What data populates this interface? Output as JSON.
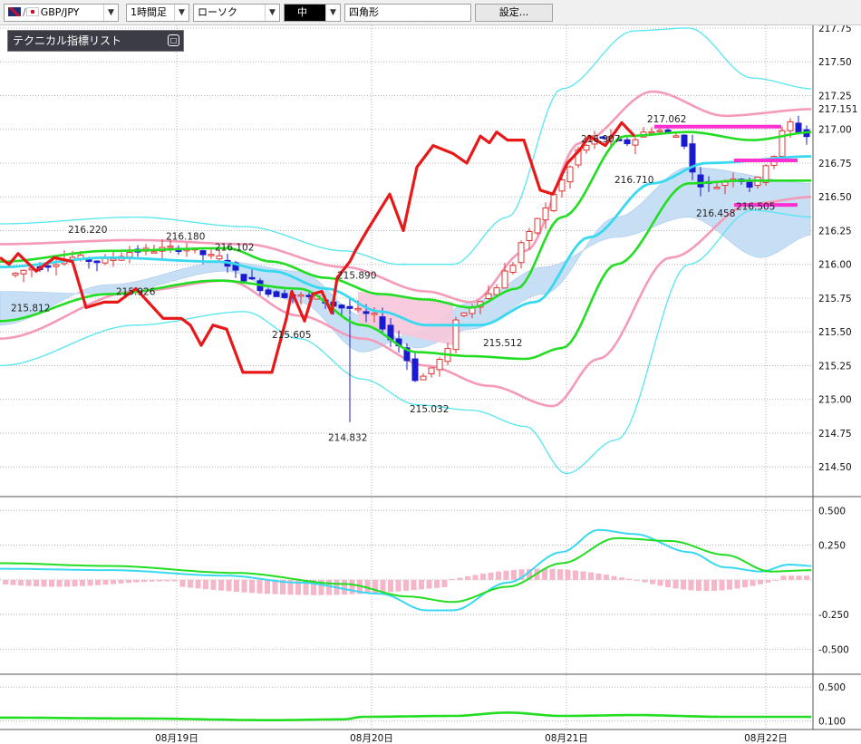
{
  "toolbar": {
    "symbol": "GBP/JPY",
    "timeframe": "1時間足",
    "chart_type": "ローソク",
    "line_width": "中",
    "shape": "四角形",
    "settings_label": "設定..."
  },
  "indicator_list": {
    "label": "テクニカル指標リスト"
  },
  "colors": {
    "bull_candle": "#e03030",
    "bear_candle": "#1a1ad0",
    "chikou": "#e81818",
    "moving_average": "#22dd22",
    "bollinger_inner": "#f59ab8",
    "bollinger_outer": "#55e6f0",
    "kijun": "#38d8f0",
    "cloud": "#c6dff5",
    "cloud_negative": "#f7c6da",
    "support_lines": "#ff2fd0",
    "macd_hist": "#f5b6c8"
  },
  "chart_data": [
    {
      "type": "candlestick",
      "panel": "price",
      "y_ticks": [
        "217.75",
        "217.50",
        "217.25",
        "217.151",
        "217.00",
        "216.75",
        "216.50",
        "216.25",
        "216.00",
        "215.75",
        "215.50",
        "215.25",
        "215.00",
        "214.75",
        "214.50"
      ],
      "x_ticks": [
        "08月19日",
        "08月20日",
        "08月21日",
        "08月22日"
      ],
      "ylim": [
        214.28,
        217.77
      ],
      "last_price": 217.151,
      "annotations": [
        "216.220",
        "216.180",
        "216.102",
        "215.812",
        "215.926",
        "215.890",
        "215.605",
        "214.832",
        "215.032",
        "215.512",
        "216.907",
        "217.062",
        "216.710",
        "216.458",
        "216.505"
      ]
    },
    {
      "type": "line",
      "panel": "macd",
      "y_ticks": [
        "0.500",
        "0.250",
        "-0.250",
        "-0.500"
      ],
      "ylim": [
        -0.68,
        0.58
      ]
    },
    {
      "type": "line",
      "panel": "lower",
      "y_ticks": [
        "0.500",
        "0.100"
      ],
      "ylim": [
        0.0,
        0.62
      ]
    }
  ]
}
